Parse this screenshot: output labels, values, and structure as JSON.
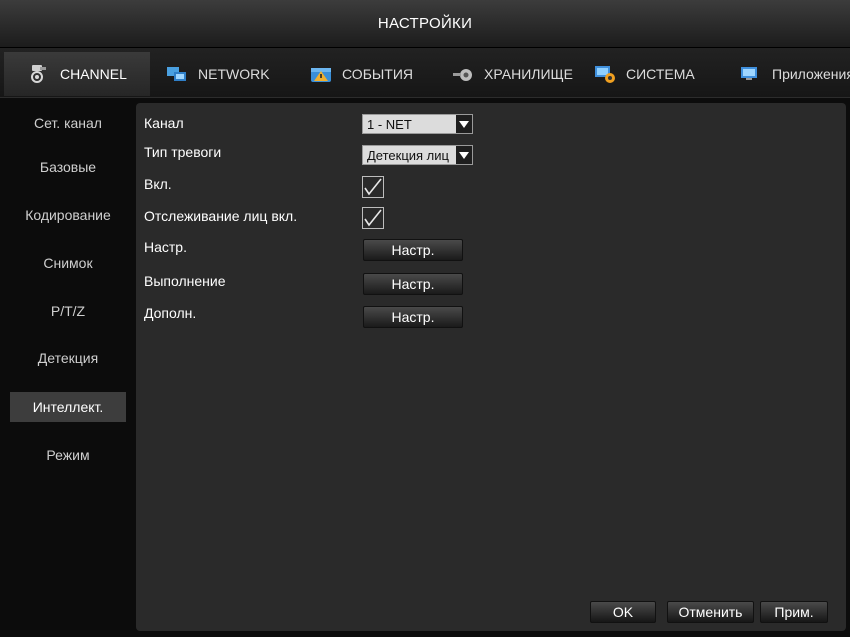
{
  "window": {
    "title": "НАСТРОЙКИ"
  },
  "tabs": [
    {
      "label": "CHANNEL",
      "icon": "camera-icon",
      "active": true
    },
    {
      "label": "NETWORK",
      "icon": "network-icon",
      "active": false
    },
    {
      "label": "СОБЫТИЯ",
      "icon": "alarm-icon",
      "active": false
    },
    {
      "label": "ХРАНИЛИЩЕ",
      "icon": "storage-icon",
      "active": false
    },
    {
      "label": "СИСТЕМА",
      "icon": "system-icon",
      "active": false
    },
    {
      "label": "Приложения",
      "icon": "apps-icon",
      "active": false
    }
  ],
  "sidebar": {
    "items": [
      {
        "label": "Сет. канал"
      },
      {
        "label": "Базовые"
      },
      {
        "label": "Кодирование"
      },
      {
        "label": "Снимок"
      },
      {
        "label": "P/T/Z"
      },
      {
        "label": "Детекция"
      },
      {
        "label": "Интеллект.",
        "active": true
      },
      {
        "label": "Режим"
      }
    ]
  },
  "form": {
    "channel_label": "Канал",
    "channel_value": "1 - NET",
    "alarm_type_label": "Тип тревоги",
    "alarm_type_value": "Детекция лиц",
    "enable_label": "Вкл.",
    "enable_checked": true,
    "face_tracking_label": "Отслеживание лиц вкл.",
    "face_tracking_checked": true,
    "setup_label": "Настр.",
    "execution_label": "Выполнение",
    "extra_label": "Дополн.",
    "setup_button": "Настр."
  },
  "footer": {
    "ok": "OK",
    "cancel": "Отменить",
    "apply": "Прим."
  },
  "colors": {
    "background": "#0c0c0c",
    "panel": "#2a2a2a",
    "sidebar_active": "#3d3d3d",
    "select_bg": "#dcdcdc"
  }
}
